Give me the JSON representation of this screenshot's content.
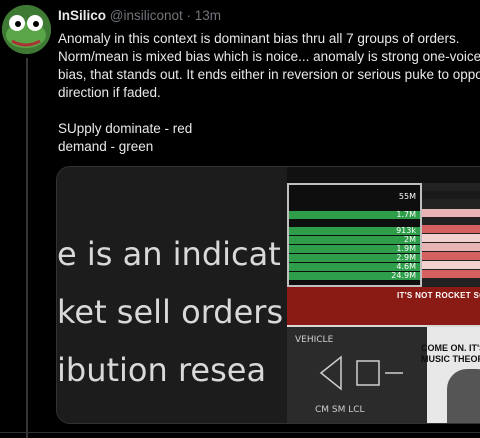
{
  "author": {
    "name": "InSilico",
    "handle": "@insiliconot",
    "time": "· 13m"
  },
  "tweet": {
    "line1": "Anomaly in this context is dominant bias thru all 7 groups of orders.",
    "line2": "Norm/mean is mixed bias which is noice... anomaly is strong one-voiced",
    "line3": "bias, that stands out. It ends either in reversion or serious puke to oppo",
    "line4": "direction if faded.",
    "line5": "SUpply dominate - red",
    "line6": "demand - green"
  },
  "media": {
    "left_lines": [
      "e is an indicat",
      "ket sell orders",
      "ibution resea"
    ],
    "depth_values": [
      "55M",
      "1.7M",
      "913k",
      "2M",
      "1.9M",
      "2.9M",
      "4.6M",
      "24.9M"
    ],
    "caption_top": "IT'S NOT ROCKET SCI",
    "caption_right": [
      "COME ON. IT'S N",
      "MUSIC THEORY"
    ],
    "board_words": [
      "VEHICLE",
      "CM  SM  LCL"
    ]
  },
  "colors": {
    "supply": "#c0392b",
    "demand": "#27ae60"
  }
}
